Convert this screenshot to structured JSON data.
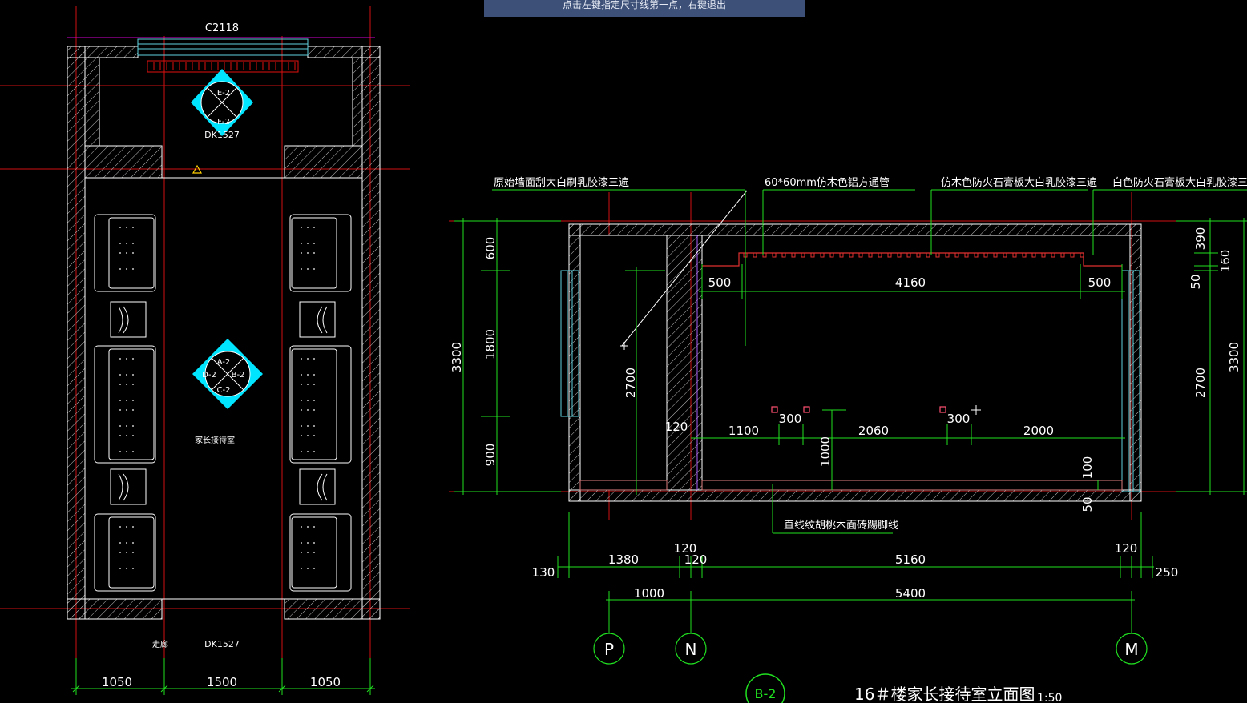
{
  "status_prompt": "点击左键指定尺寸线第一点，右键退出",
  "plan": {
    "window_label": "C2118",
    "door_labels": [
      "DK1527",
      "DK1527"
    ],
    "room_label": "家长接待室",
    "corridor_label": "走廊",
    "elevation_marker_top": [
      "E-2",
      "F-2"
    ],
    "elevation_marker_center": [
      "A-2",
      "B-2",
      "C-2",
      "D-2"
    ],
    "bottom_dims": [
      "1050",
      "1500",
      "1050"
    ]
  },
  "elevation": {
    "callouts": [
      "原始墙面刮大白刷乳胶漆三遍",
      "60*60mm仿木色铝方通管",
      "仿木色防火石膏板大白乳胶漆三遍",
      "白色防火石膏板大白乳胶漆三遍",
      "直线纹胡桃木面砖踢脚线"
    ],
    "dims_left": [
      "3300",
      "600",
      "1800",
      "900",
      "2700"
    ],
    "dims_right": [
      "390",
      "160",
      "50",
      "3300",
      "2700"
    ],
    "dims_top_row": [
      "500",
      "4160",
      "500"
    ],
    "dims_mid_row": [
      "120",
      "1100",
      "300",
      "2060",
      "300",
      "2000"
    ],
    "dims_vertical_inner": [
      "1000",
      "100",
      "50"
    ],
    "dims_bottom_row1": [
      "130",
      "1380",
      "120",
      "120",
      "5160",
      "120",
      "250"
    ],
    "dims_bottom_row2": [
      "1000",
      "5400"
    ],
    "grid_axes": [
      "P",
      "N",
      "M"
    ],
    "view_tag": "B-2",
    "title": "16＃楼家长接待室立面图",
    "scale": "1:50"
  }
}
